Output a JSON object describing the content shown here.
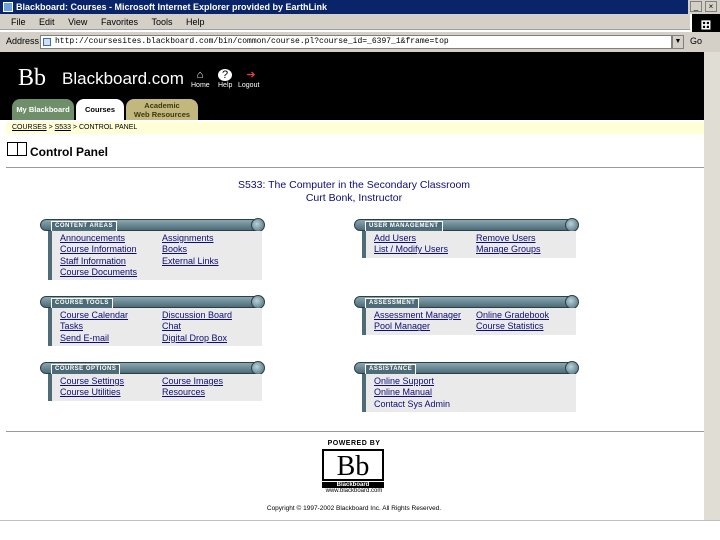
{
  "window": {
    "title": "Blackboard: Courses - Microsoft Internet Explorer provided by EarthLink",
    "min": "_",
    "close": "×"
  },
  "menu": [
    "File",
    "Edit",
    "View",
    "Favorites",
    "Tools",
    "Help"
  ],
  "address": {
    "label": "Address",
    "url": "http://coursesites.blackboard.com/bin/common/course.pl?course_id=_6397_1&frame=top",
    "dropdown": "▼",
    "go": "Go"
  },
  "header": {
    "logo_mark": "Bb",
    "logo_text": "Blackboard.com",
    "icons": [
      {
        "name": "home",
        "label": "Home",
        "glyph": "⌂"
      },
      {
        "name": "help",
        "label": "Help",
        "glyph": "?"
      },
      {
        "name": "logout",
        "label": "Logout",
        "glyph": "➜"
      }
    ],
    "tabs": {
      "my_blackboard": "My Blackboard",
      "courses": "Courses",
      "academic_line1": "Academic",
      "academic_line2": "Web Resources"
    }
  },
  "breadcrumb": {
    "item1": "COURSES",
    "sep": " > ",
    "item2": "S533",
    "item3": "CONTROL PANEL"
  },
  "page": {
    "title": "Control Panel",
    "course_line1": "S533:  The Computer in the Secondary Classroom",
    "course_line2": "Curt Bonk, Instructor"
  },
  "panels": {
    "content_areas": {
      "label": "CONTENT AREAS",
      "links": [
        "Announcements",
        "Assignments",
        "Course Information",
        "Books",
        "Staff Information",
        "External Links",
        "Course Documents"
      ]
    },
    "user_management": {
      "label": "USER MANAGEMENT",
      "links": [
        "Add Users",
        "Remove Users",
        "List / Modify Users",
        "Manage Groups"
      ]
    },
    "course_tools": {
      "label": "COURSE TOOLS",
      "links": [
        "Course Calendar",
        "Discussion Board",
        "Tasks",
        "Chat",
        "Send E-mail",
        "Digital Drop Box"
      ]
    },
    "assessment": {
      "label": "ASSESSMENT",
      "links": [
        "Assessment Manager",
        "Online Gradebook",
        "Pool Manager",
        "Course Statistics"
      ]
    },
    "course_options": {
      "label": "COURSE OPTIONS",
      "links": [
        "Course Settings",
        "Course Images",
        "Course Utilities",
        "Resources"
      ]
    },
    "assistance": {
      "label": "ASSISTANCE",
      "links": [
        "Online Support",
        "Online Manual",
        "Contact Sys Admin"
      ]
    }
  },
  "footer": {
    "powered_by": "POWERED BY",
    "mark": "Bb",
    "word": "Blackboard",
    "url": "www.blackboard.com",
    "copyright": "Copyright © 1997-2002 Blackboard Inc. All Rights Reserved."
  }
}
